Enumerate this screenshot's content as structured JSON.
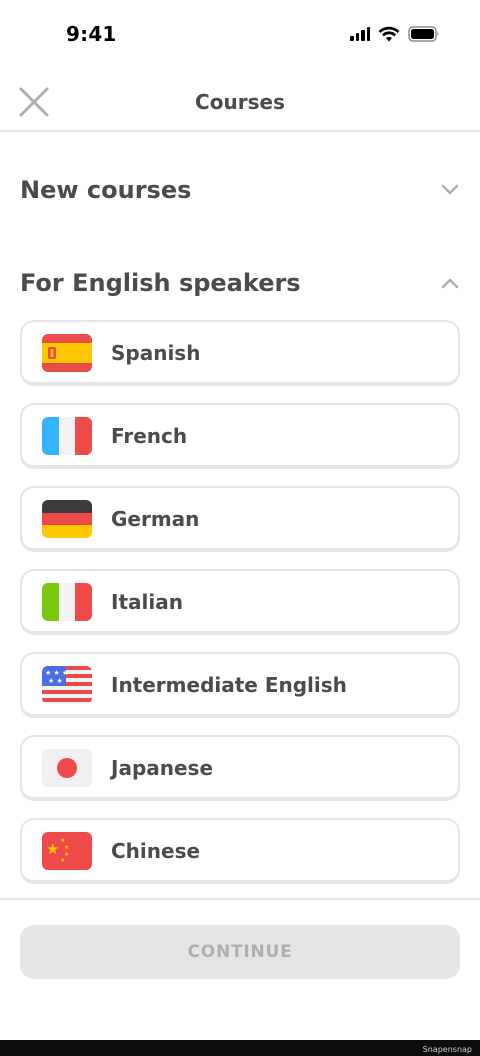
{
  "status_bar": {
    "time": "9:41"
  },
  "header": {
    "title": "Courses",
    "close_icon": "close-icon"
  },
  "sections": {
    "new_courses": {
      "title": "New courses",
      "icon": "chevron-down-icon",
      "expanded": false
    },
    "english_speakers": {
      "title": "For English speakers",
      "icon": "chevron-up-icon",
      "expanded": true
    }
  },
  "courses": [
    {
      "name": "Spanish",
      "flag": "spain-flag-icon"
    },
    {
      "name": "French",
      "flag": "france-flag-icon"
    },
    {
      "name": "German",
      "flag": "germany-flag-icon"
    },
    {
      "name": "Italian",
      "flag": "italy-flag-icon"
    },
    {
      "name": "Intermediate English",
      "flag": "usa-flag-icon"
    },
    {
      "name": "Japanese",
      "flag": "japan-flag-icon"
    },
    {
      "name": "Chinese",
      "flag": "china-flag-icon"
    }
  ],
  "footer": {
    "continue_label": "CONTINUE",
    "watermark": "Snapensnap"
  },
  "colors": {
    "text": "#4b4b4b",
    "border": "#e5e5e5",
    "disabled_bg": "#e5e5e5",
    "disabled_text": "#afafaf"
  }
}
